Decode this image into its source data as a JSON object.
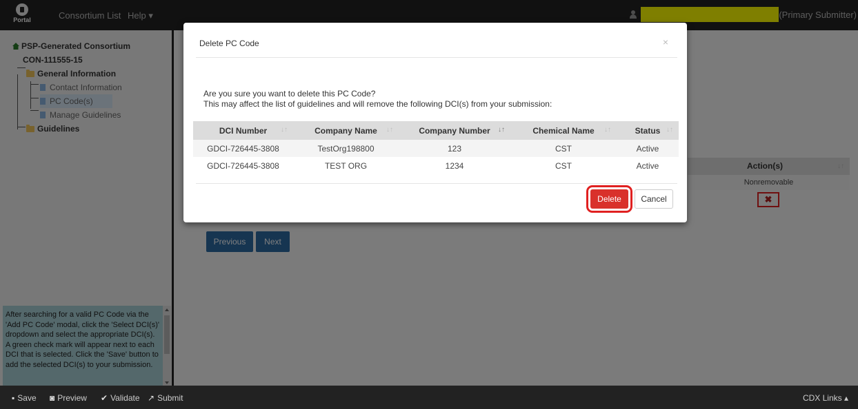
{
  "navbar": {
    "logo_text": "Portal",
    "links": [
      "Consortium List",
      "Help ▾"
    ],
    "user_role": "(Primary Submitter)"
  },
  "sidebar": {
    "root_label": "PSP-Generated Consortium",
    "consortium_id": "CON-111555-15",
    "general_info_label": "General Information",
    "items": [
      "Contact Information",
      "PC Code(s)",
      "Manage Guidelines"
    ],
    "guidelines_label": "Guidelines",
    "help_text": "After searching for a valid PC Code via the 'Add PC Code' modal, click the 'Select DCI(s)' dropdown and select the appropriate DCI(s). A green check mark will appear next to each DCI that is selected. Click the 'Save' button to add the selected DCI(s) to your submission."
  },
  "background": {
    "actions_header": "Action(s)",
    "nonremovable": "Nonremovable",
    "remove_glyph": "✖",
    "previous_label": "Previous",
    "next_label": "Next"
  },
  "modal": {
    "title": "Delete PC Code",
    "close_glyph": "×",
    "message_line1": "Are you sure you want to delete this PC Code?",
    "message_line2": "This may affect the list of guidelines and will remove the following DCI(s) from your submission:",
    "columns": [
      "DCI Number",
      "Company Name",
      "Company Number",
      "Chemical Name",
      "Status"
    ],
    "rows": [
      [
        "GDCI-726445-3808",
        "TestOrg198800",
        "123",
        "CST",
        "Active"
      ],
      [
        "GDCI-726445-3808",
        "TEST ORG",
        "1234",
        "CST",
        "Active"
      ]
    ],
    "delete_label": "Delete",
    "cancel_label": "Cancel"
  },
  "footer": {
    "save_label": "Save",
    "preview_label": "Preview",
    "validate_label": "Validate",
    "submit_label": "Submit",
    "cdx_links_label": "CDX Links ▴"
  },
  "colors": {
    "navbar_bg": "#222222",
    "delete_button": "#d9312b",
    "highlight_outline": "#e02020",
    "primary_button": "#2d6aa3",
    "help_box": "#a8d0d6",
    "redaction": "#ffff00"
  },
  "icons": [
    "portal-logo-icon",
    "user-icon",
    "home-icon",
    "folder-icon",
    "document-icon",
    "sort-icon",
    "close-icon",
    "remove-x-icon",
    "save-icon",
    "camera-icon",
    "check-icon",
    "submit-icon"
  ]
}
